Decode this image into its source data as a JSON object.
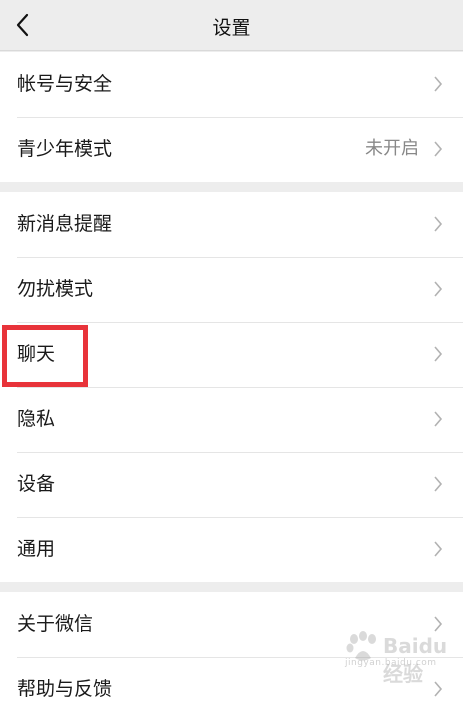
{
  "header": {
    "title": "设置",
    "back_icon": "chevron-left-icon"
  },
  "groups": [
    {
      "items": [
        {
          "label": "帐号与安全",
          "value": ""
        },
        {
          "label": "青少年模式",
          "value": "未开启"
        }
      ]
    },
    {
      "items": [
        {
          "label": "新消息提醒",
          "value": ""
        },
        {
          "label": "勿扰模式",
          "value": ""
        },
        {
          "label": "聊天",
          "value": "",
          "highlighted": true
        },
        {
          "label": "隐私",
          "value": ""
        },
        {
          "label": "设备",
          "value": ""
        },
        {
          "label": "通用",
          "value": ""
        }
      ]
    },
    {
      "items": [
        {
          "label": "关于微信",
          "value": ""
        },
        {
          "label": "帮助与反馈",
          "value": ""
        }
      ]
    }
  ],
  "watermark": {
    "text": "Baidu经验",
    "sub": "jingyan.baidu.com"
  },
  "colors": {
    "background": "#ededed",
    "highlight": "#e8333a",
    "chevron": "#b2b2b2"
  }
}
